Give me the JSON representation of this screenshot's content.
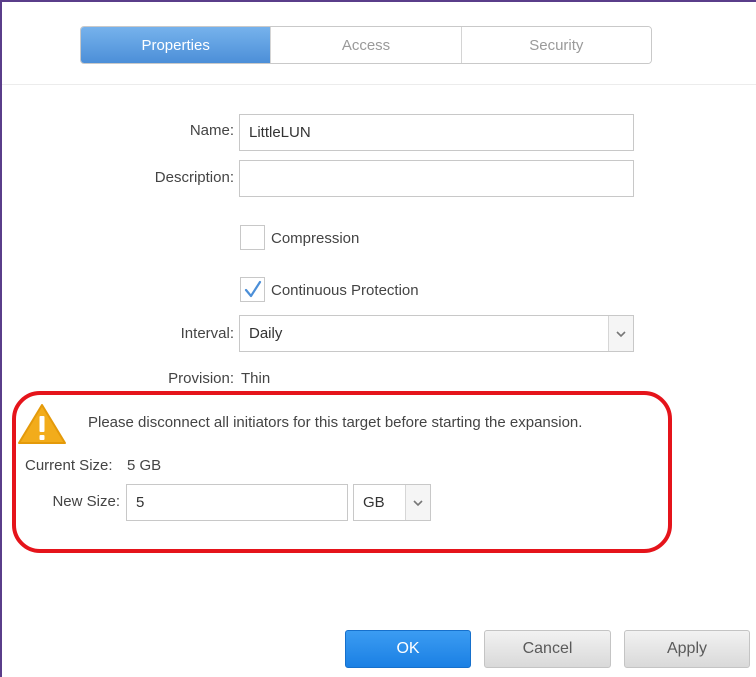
{
  "tabs": [
    {
      "label": "Properties",
      "active": true
    },
    {
      "label": "Access",
      "active": false
    },
    {
      "label": "Security",
      "active": false
    }
  ],
  "form": {
    "name_label": "Name:",
    "name_value": "LittleLUN",
    "description_label": "Description:",
    "description_value": "",
    "compression_label": "Compression",
    "compression_checked": false,
    "continuous_protection_label": "Continuous Protection",
    "continuous_protection_checked": true,
    "interval_label": "Interval:",
    "interval_value": "Daily",
    "provision_label": "Provision:",
    "provision_value": "Thin"
  },
  "expansion": {
    "warning_text": "Please disconnect all initiators for this target before starting the expansion.",
    "current_size_label": "Current Size:",
    "current_size_value": "5 GB",
    "new_size_label": "New Size:",
    "new_size_value": "5",
    "unit_value": "GB"
  },
  "buttons": {
    "ok": "OK",
    "cancel": "Cancel",
    "apply": "Apply"
  },
  "colors": {
    "active_tab": "#4c8fd8",
    "ok_button": "#1b80e4",
    "highlight_border": "#e5141b",
    "warning_icon": "#f2ac1b"
  },
  "icons": {
    "warning": "warning-triangle-icon",
    "check": "check-icon",
    "dropdown": "chevron-down-icon"
  }
}
